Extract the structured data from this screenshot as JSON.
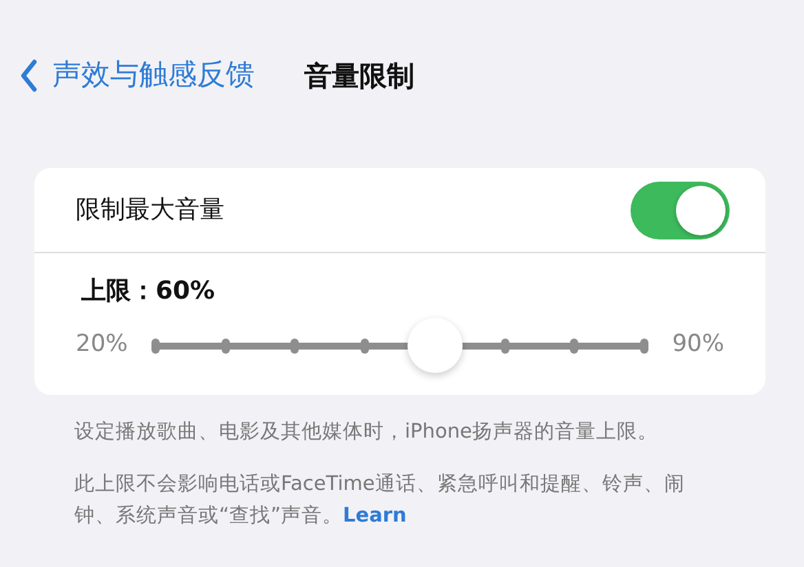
{
  "nav": {
    "back_label": "声效与触感反馈",
    "title": "音量限制"
  },
  "limit": {
    "label": "限制最大音量",
    "on": true
  },
  "slider": {
    "label": "上限：60%",
    "min_label": "20%",
    "max_label": "90%",
    "level": 0.5714
  },
  "footer": {
    "line1": "设定播放歌曲、电影及其他媒体时，iPhone扬声器的音量上限。",
    "line2": "此上限不会影响电话或FaceTime通话、紧急呼叫和提醒、铃声、闹钟、系统声音或“查找”声音。",
    "link": "Learn"
  }
}
